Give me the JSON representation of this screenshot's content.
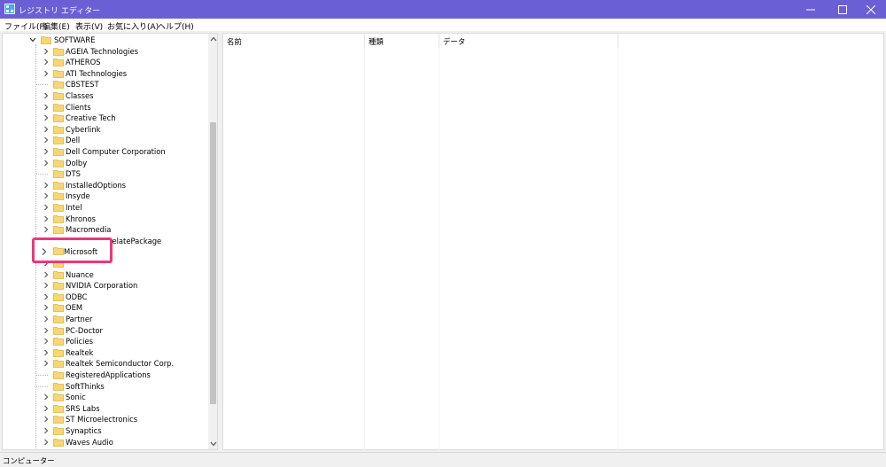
{
  "window": {
    "title": "レジストリ エディター",
    "icon": "registry-editor-icon",
    "controls": [
      "minimize-icon",
      "maximize-icon",
      "close-icon"
    ]
  },
  "menu": [
    "ファイル(F)",
    "編集(E)",
    "表示(V)",
    "お気に入り(A)",
    "ヘルプ(H)"
  ],
  "tree": {
    "root": "SOFTWARE",
    "items": [
      {
        "label": "AGEIA Technologies",
        "expandable": true
      },
      {
        "label": "ATHEROS",
        "expandable": true
      },
      {
        "label": "ATI Technologies",
        "expandable": true
      },
      {
        "label": "CBSTEST",
        "expandable": false
      },
      {
        "label": "Classes",
        "expandable": true
      },
      {
        "label": "Clients",
        "expandable": true
      },
      {
        "label": "Creative Tech",
        "expandable": true
      },
      {
        "label": "Cyberlink",
        "expandable": true
      },
      {
        "label": "Dell",
        "expandable": true
      },
      {
        "label": "Dell Computer Corporation",
        "expandable": true
      },
      {
        "label": "Dolby",
        "expandable": true
      },
      {
        "label": "DTS",
        "expandable": false
      },
      {
        "label": "InstalledOptions",
        "expandable": true
      },
      {
        "label": "Insyde",
        "expandable": true
      },
      {
        "label": "Intel",
        "expandable": true
      },
      {
        "label": "Khronos",
        "expandable": true
      },
      {
        "label": "Macromedia",
        "expandable": true
      },
      {
        "label": "DelatePackage",
        "expandable": true
      },
      {
        "label": "Microsoft",
        "expandable": true
      },
      {
        "label": "",
        "expandable": true
      },
      {
        "label": "Nuance",
        "expandable": true
      },
      {
        "label": "NVIDIA Corporation",
        "expandable": true
      },
      {
        "label": "ODBC",
        "expandable": true
      },
      {
        "label": "OEM",
        "expandable": true
      },
      {
        "label": "Partner",
        "expandable": true
      },
      {
        "label": "PC-Doctor",
        "expandable": true
      },
      {
        "label": "Policies",
        "expandable": true
      },
      {
        "label": "Realtek",
        "expandable": true
      },
      {
        "label": "Realtek Semiconductor Corp.",
        "expandable": true
      },
      {
        "label": "RegisteredApplications",
        "expandable": false
      },
      {
        "label": "SoftThinks",
        "expandable": false
      },
      {
        "label": "Sonic",
        "expandable": true
      },
      {
        "label": "SRS Labs",
        "expandable": true
      },
      {
        "label": "ST Microelectronics",
        "expandable": true
      },
      {
        "label": "Synaptics",
        "expandable": true
      },
      {
        "label": "Waves Audio",
        "expandable": true
      }
    ],
    "highlighted": "Microsoft",
    "highlight_color": "#f0357c"
  },
  "list": {
    "columns": [
      "名前",
      "種類",
      "データ"
    ]
  },
  "status": "コンピューター",
  "colors": {
    "titlebar": "#6b5fd6",
    "folder": "#f7d774",
    "highlight": "#f0357c"
  }
}
